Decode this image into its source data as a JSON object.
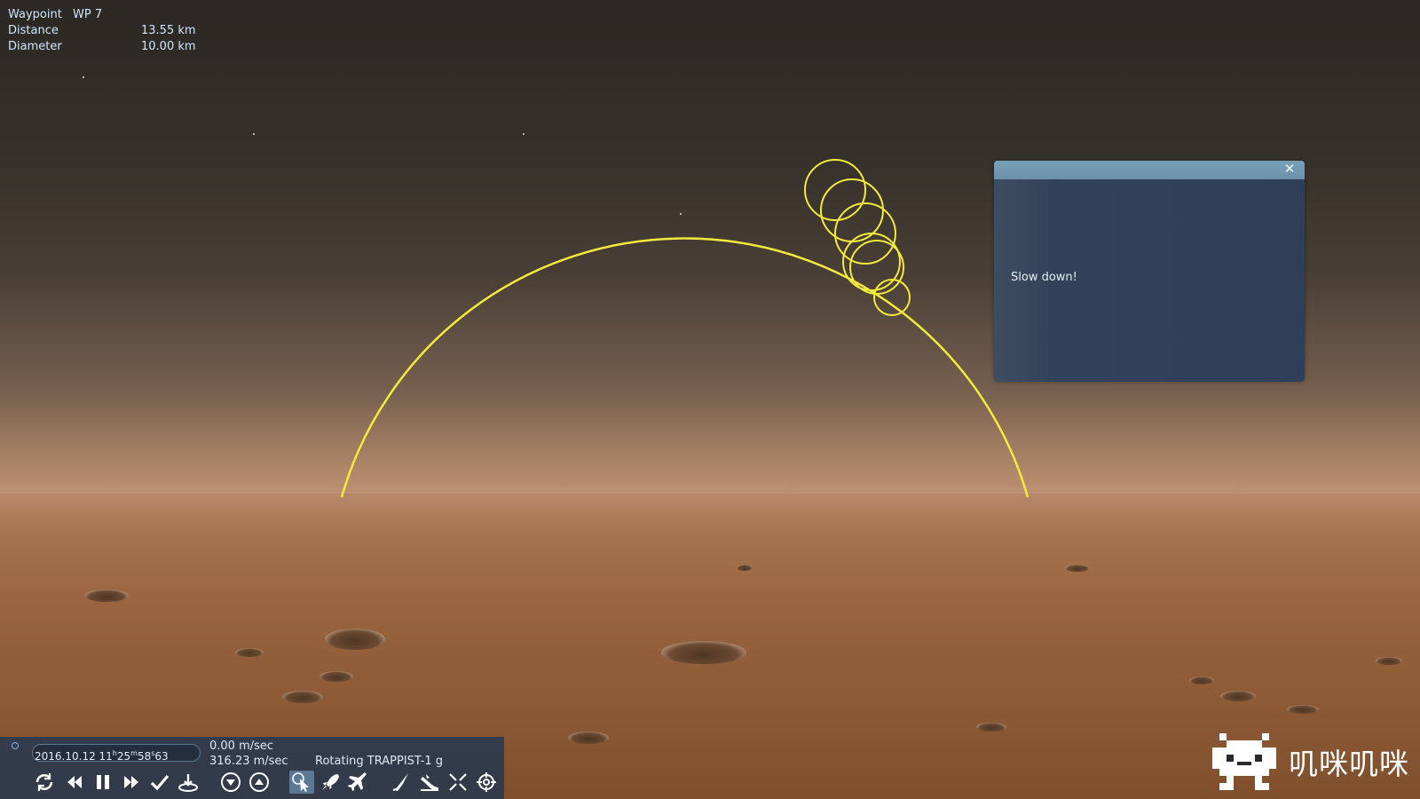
{
  "hud": {
    "waypoint_label": "Waypoint",
    "waypoint_value": "WP 7",
    "distance_label": "Distance",
    "distance_value": "13.55 km",
    "diameter_label": "Diameter",
    "diameter_value": "10.00 km"
  },
  "dialog": {
    "close_icon": "close-icon",
    "message": "Slow down!"
  },
  "toolbar": {
    "date_main": "2016.10.12 11",
    "date_h": "h",
    "date_min": "25",
    "date_m": "m",
    "date_sec": "58",
    "date_s": "s",
    "date_frac": "63",
    "speed_time": "0.00 m/sec",
    "speed_velocity": "316.23 m/sec",
    "camera_mode": "Rotating TRAPPIST-1 g",
    "icons": [
      "refresh-icon",
      "rewind-icon",
      "pause-icon",
      "fast-forward-icon",
      "check-icon",
      "land-icon",
      "descend-icon",
      "ascend-icon",
      "select-icon",
      "rocket-icon",
      "plane-icon",
      "launch-icon",
      "ramp-icon",
      "collapse-icon",
      "target-icon"
    ]
  },
  "watermark": {
    "text": "叽咪叽咪"
  },
  "colors": {
    "waypoint_ring": "#f2ea3c",
    "hud_text": "#cfe6ff",
    "toolbar_bg": "#2c3a4e",
    "dialog_titlebar": "#7aa0b8"
  }
}
